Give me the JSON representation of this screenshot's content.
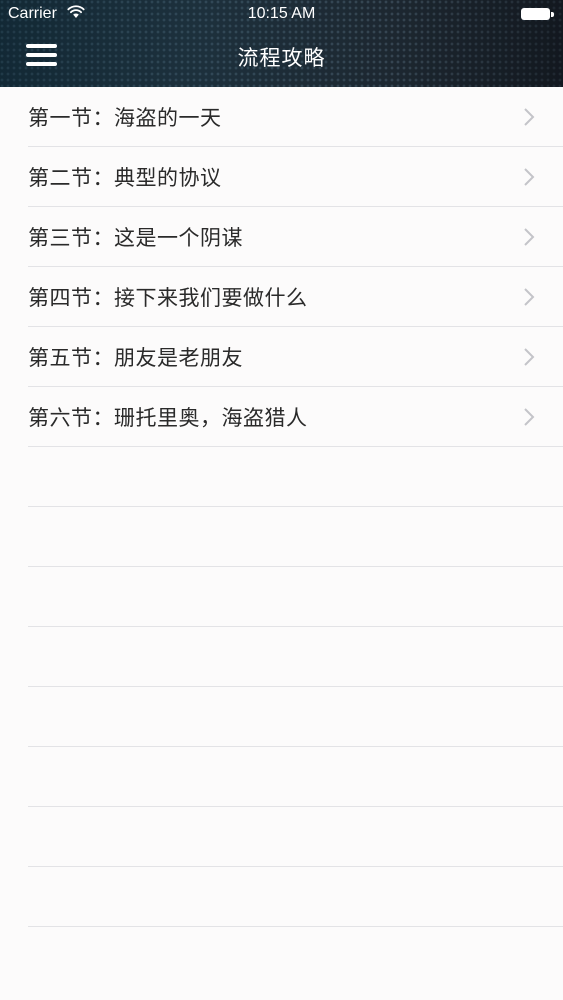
{
  "status_bar": {
    "carrier": "Carrier",
    "time": "10:15 AM",
    "wifi_icon": "wifi-icon",
    "battery_icon": "battery-icon"
  },
  "nav_bar": {
    "title": "流程攻略",
    "menu_icon": "hamburger-menu-icon"
  },
  "sections": [
    {
      "label": "第一节：海盗的一天"
    },
    {
      "label": "第二节：典型的协议"
    },
    {
      "label": "第三节：这是一个阴谋"
    },
    {
      "label": "第四节：接下来我们要做什么"
    },
    {
      "label": "第五节：朋友是老朋友"
    },
    {
      "label": "第六节：珊托里奥，海盗猎人"
    }
  ],
  "colors": {
    "nav_background": "#1f2a33",
    "list_background": "#fcfbfb",
    "separator": "#e3e3e6",
    "chevron": "#c4c4c9",
    "text": "#2a2a2a"
  }
}
